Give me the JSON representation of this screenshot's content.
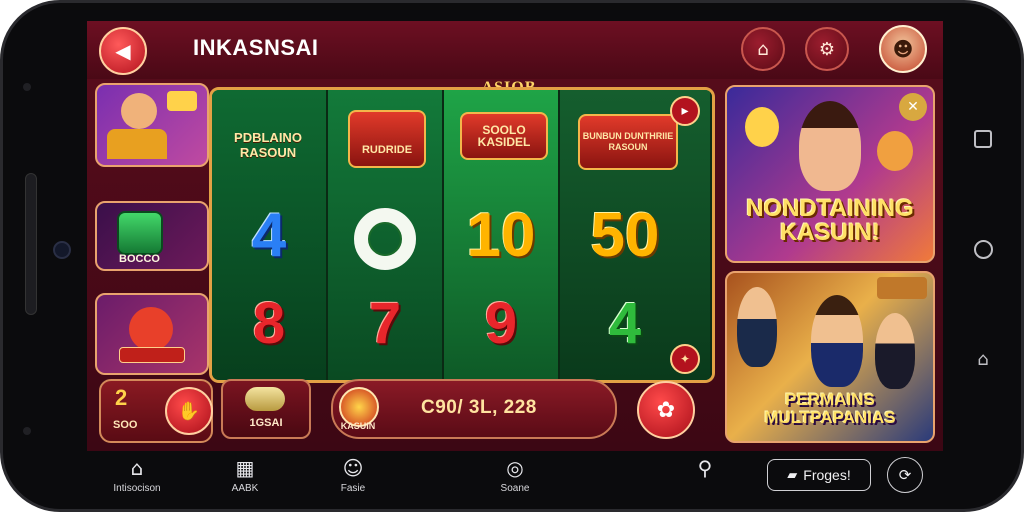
{
  "header": {
    "title": "INKASNSAI",
    "back_icon": "back-arrow-icon",
    "buttons": [
      {
        "icon": "home-icon",
        "glyph": "⌂"
      },
      {
        "icon": "settings-icon",
        "glyph": "⚙"
      }
    ],
    "avatar_icon": "user-avatar-icon"
  },
  "left_tiles": {
    "tile_2_label": "BOCCO"
  },
  "reels": {
    "marquee": "ASIOB",
    "columns": [
      {
        "label": "PDBLAINO RASOUN",
        "top": "4",
        "bottom": "8",
        "top_color": "blue",
        "bottom_color": "red"
      },
      {
        "label": "RUDRIDE",
        "top": "O",
        "bottom": "7",
        "top_color": "green",
        "bottom_color": "red"
      },
      {
        "label": "SOOLO KASIDEL",
        "top": "10",
        "bottom": "9",
        "top_color": "gold",
        "bottom_color": "red"
      },
      {
        "label": "BUNBUN DUNTHRIIE RASOUN",
        "top": "50",
        "bottom": "4",
        "top_color": "gold",
        "bottom_color": "green"
      }
    ]
  },
  "banners": {
    "top_title": "NONDTAINING KASUIN!",
    "bottom_title": "PERMAINS MULTPAPANIAS"
  },
  "bottom_bar": {
    "coins_value": "2",
    "coins_sub": "SOO",
    "bet_label": "1GSAI",
    "spin_sub": "KASUIN",
    "spin_value": "C90/ 3L, 228"
  },
  "nav": {
    "items": [
      {
        "label": "Intisocison",
        "icon": "home-icon",
        "glyph": "⌂"
      },
      {
        "label": "AABK",
        "icon": "qr-code-icon",
        "glyph": "▦"
      },
      {
        "label": "Fasie",
        "icon": "profile-icon",
        "glyph": "☺"
      },
      {
        "label": "Soane",
        "icon": "camera-icon",
        "glyph": "◎"
      },
      {
        "label": "",
        "icon": "search-icon",
        "glyph": "⚲"
      }
    ],
    "pill_label": "Froges!",
    "pill_icon": "folder-icon",
    "round_icon": "refresh-icon"
  },
  "colors": {
    "accent_red": "#b3121e",
    "gold": "#ffb400",
    "background": "#5a0d1c"
  }
}
